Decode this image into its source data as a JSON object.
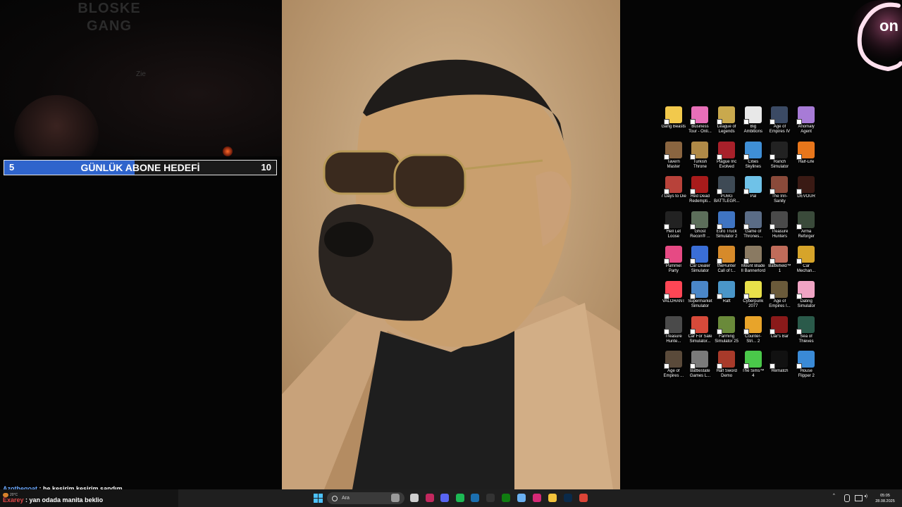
{
  "webcam": {
    "wall_text_line1": "BLOSKE",
    "wall_text_line2": "GANG",
    "mark": "Zie"
  },
  "goal": {
    "start": "5",
    "title": "GÜNLÜK ABONE HEDEFİ",
    "end": "10",
    "progress": 0.48,
    "fill_color": "#2f64cc"
  },
  "logo": {
    "text": "on"
  },
  "desktop_icons": [
    {
      "label": "Gang Beasts",
      "color": "#f2c94c"
    },
    {
      "label": "Business Tour - Onli...",
      "color": "#e86fb8"
    },
    {
      "label": "League of Legends",
      "color": "#c9a94d"
    },
    {
      "label": "Big Ambitions",
      "color": "#e8e8e8"
    },
    {
      "label": "Age of Empires IV",
      "color": "#3b4a64"
    },
    {
      "label": "Anomaly Agent",
      "color": "#a77bd6"
    },
    {
      "label": "Tavern Master",
      "color": "#8a6540"
    },
    {
      "label": "Turkish Throne",
      "color": "#b08a47"
    },
    {
      "label": "Plague Inc Evolved",
      "color": "#a8202a"
    },
    {
      "label": "Cities Skylines",
      "color": "#3f8fd6"
    },
    {
      "label": "Ranch Simulator",
      "color": "#222222"
    },
    {
      "label": "Half-Life",
      "color": "#e8761b"
    },
    {
      "label": "7 Days to Die",
      "color": "#b8423a"
    },
    {
      "label": "Red Dead Redempti...",
      "color": "#a81b1b"
    },
    {
      "label": "PUBG BATTLEGR...",
      "color": "#3e4a55"
    },
    {
      "label": "Pal",
      "color": "#6fc2e8"
    },
    {
      "label": "The Inn-Sanity",
      "color": "#8a4a3a"
    },
    {
      "label": "DEVOUR",
      "color": "#3a1a14"
    },
    {
      "label": "Hell Let Loose",
      "color": "#222222"
    },
    {
      "label": "Ghost Recon® ...",
      "color": "#5c6e5a"
    },
    {
      "label": "Euro Truck Simulator 2",
      "color": "#3f74c2"
    },
    {
      "label": "Game of Thrones...",
      "color": "#5a6c86"
    },
    {
      "label": "Treasure Hunters",
      "color": "#4a4a4a"
    },
    {
      "label": "Arma Reforger",
      "color": "#3a4a3a"
    },
    {
      "label": "Pummel Party",
      "color": "#e64a84"
    },
    {
      "label": "Car Dealer Simulator",
      "color": "#3a6ed6"
    },
    {
      "label": "theHunter Call of t...",
      "color": "#d68a2a"
    },
    {
      "label": "Mount Blade II Bannerlord",
      "color": "#8a7a62"
    },
    {
      "label": "Battlefield™ 1",
      "color": "#c06c5a"
    },
    {
      "label": "Car Mechan...",
      "color": "#d6a42a"
    },
    {
      "label": "VALORANT",
      "color": "#ff4655"
    },
    {
      "label": "Supermarket Simulator",
      "color": "#4a86c8"
    },
    {
      "label": "Raft",
      "color": "#4a96c8"
    },
    {
      "label": "Cyberpunk 2077",
      "color": "#e8e04a"
    },
    {
      "label": "Age of Empires I...",
      "color": "#6a5a3a"
    },
    {
      "label": "Dating Simulator",
      "color": "#f0a4c4"
    },
    {
      "label": "Treasure Hunte...",
      "color": "#4a4a4a"
    },
    {
      "label": "Car For Sale Simulator...",
      "color": "#d64a3a"
    },
    {
      "label": "Farming Simulator 25",
      "color": "#6a8a3a"
    },
    {
      "label": "Counter-Stri... 2",
      "color": "#e8a42a"
    },
    {
      "label": "Liar's Bar",
      "color": "#8a1a1a"
    },
    {
      "label": "Sea of Thieves",
      "color": "#2a5a4a"
    },
    {
      "label": "Age of Empires ...",
      "color": "#5a4a3a"
    },
    {
      "label": "Battlestate Games L...",
      "color": "#7a7a7a"
    },
    {
      "label": "Half Sword Demo",
      "color": "#a83a2a"
    },
    {
      "label": "The Sims™ 4",
      "color": "#4ac84a"
    },
    {
      "label": "Rematch",
      "color": "#111111"
    },
    {
      "label": "House Flipper 2",
      "color": "#3a8ad6"
    }
  ],
  "chat": [
    {
      "user": "Azothegoat",
      "text": ": he kesirim kesirim sandım"
    },
    {
      "user": "Exarey",
      "text": ": yan odada manita beklio"
    }
  ],
  "weather": {
    "temp": "20°C"
  },
  "taskbar": {
    "search_placeholder": "Ara",
    "pinned": [
      {
        "name": "search-app-icon",
        "color": "#9a9a9a"
      },
      {
        "name": "task-view-icon",
        "color": "#cfcfcf"
      },
      {
        "name": "obs-icon",
        "color": "#c2285e"
      },
      {
        "name": "discord-icon",
        "color": "#5865f2"
      },
      {
        "name": "spotify-icon",
        "color": "#1db954"
      },
      {
        "name": "steam-icon",
        "color": "#1b6fb0"
      },
      {
        "name": "epic-games-icon",
        "color": "#333333"
      },
      {
        "name": "xbox-icon",
        "color": "#107c10"
      },
      {
        "name": "copilot-icon",
        "color": "#6ab0f0"
      },
      {
        "name": "instagram-icon",
        "color": "#d62976"
      },
      {
        "name": "file-explorer-icon",
        "color": "#f3c33c"
      },
      {
        "name": "photoshop-icon",
        "color": "#0a2a4a"
      },
      {
        "name": "chrome-icon",
        "color": "#db4437"
      }
    ],
    "time": "05:05",
    "date": "28.08.2025"
  }
}
